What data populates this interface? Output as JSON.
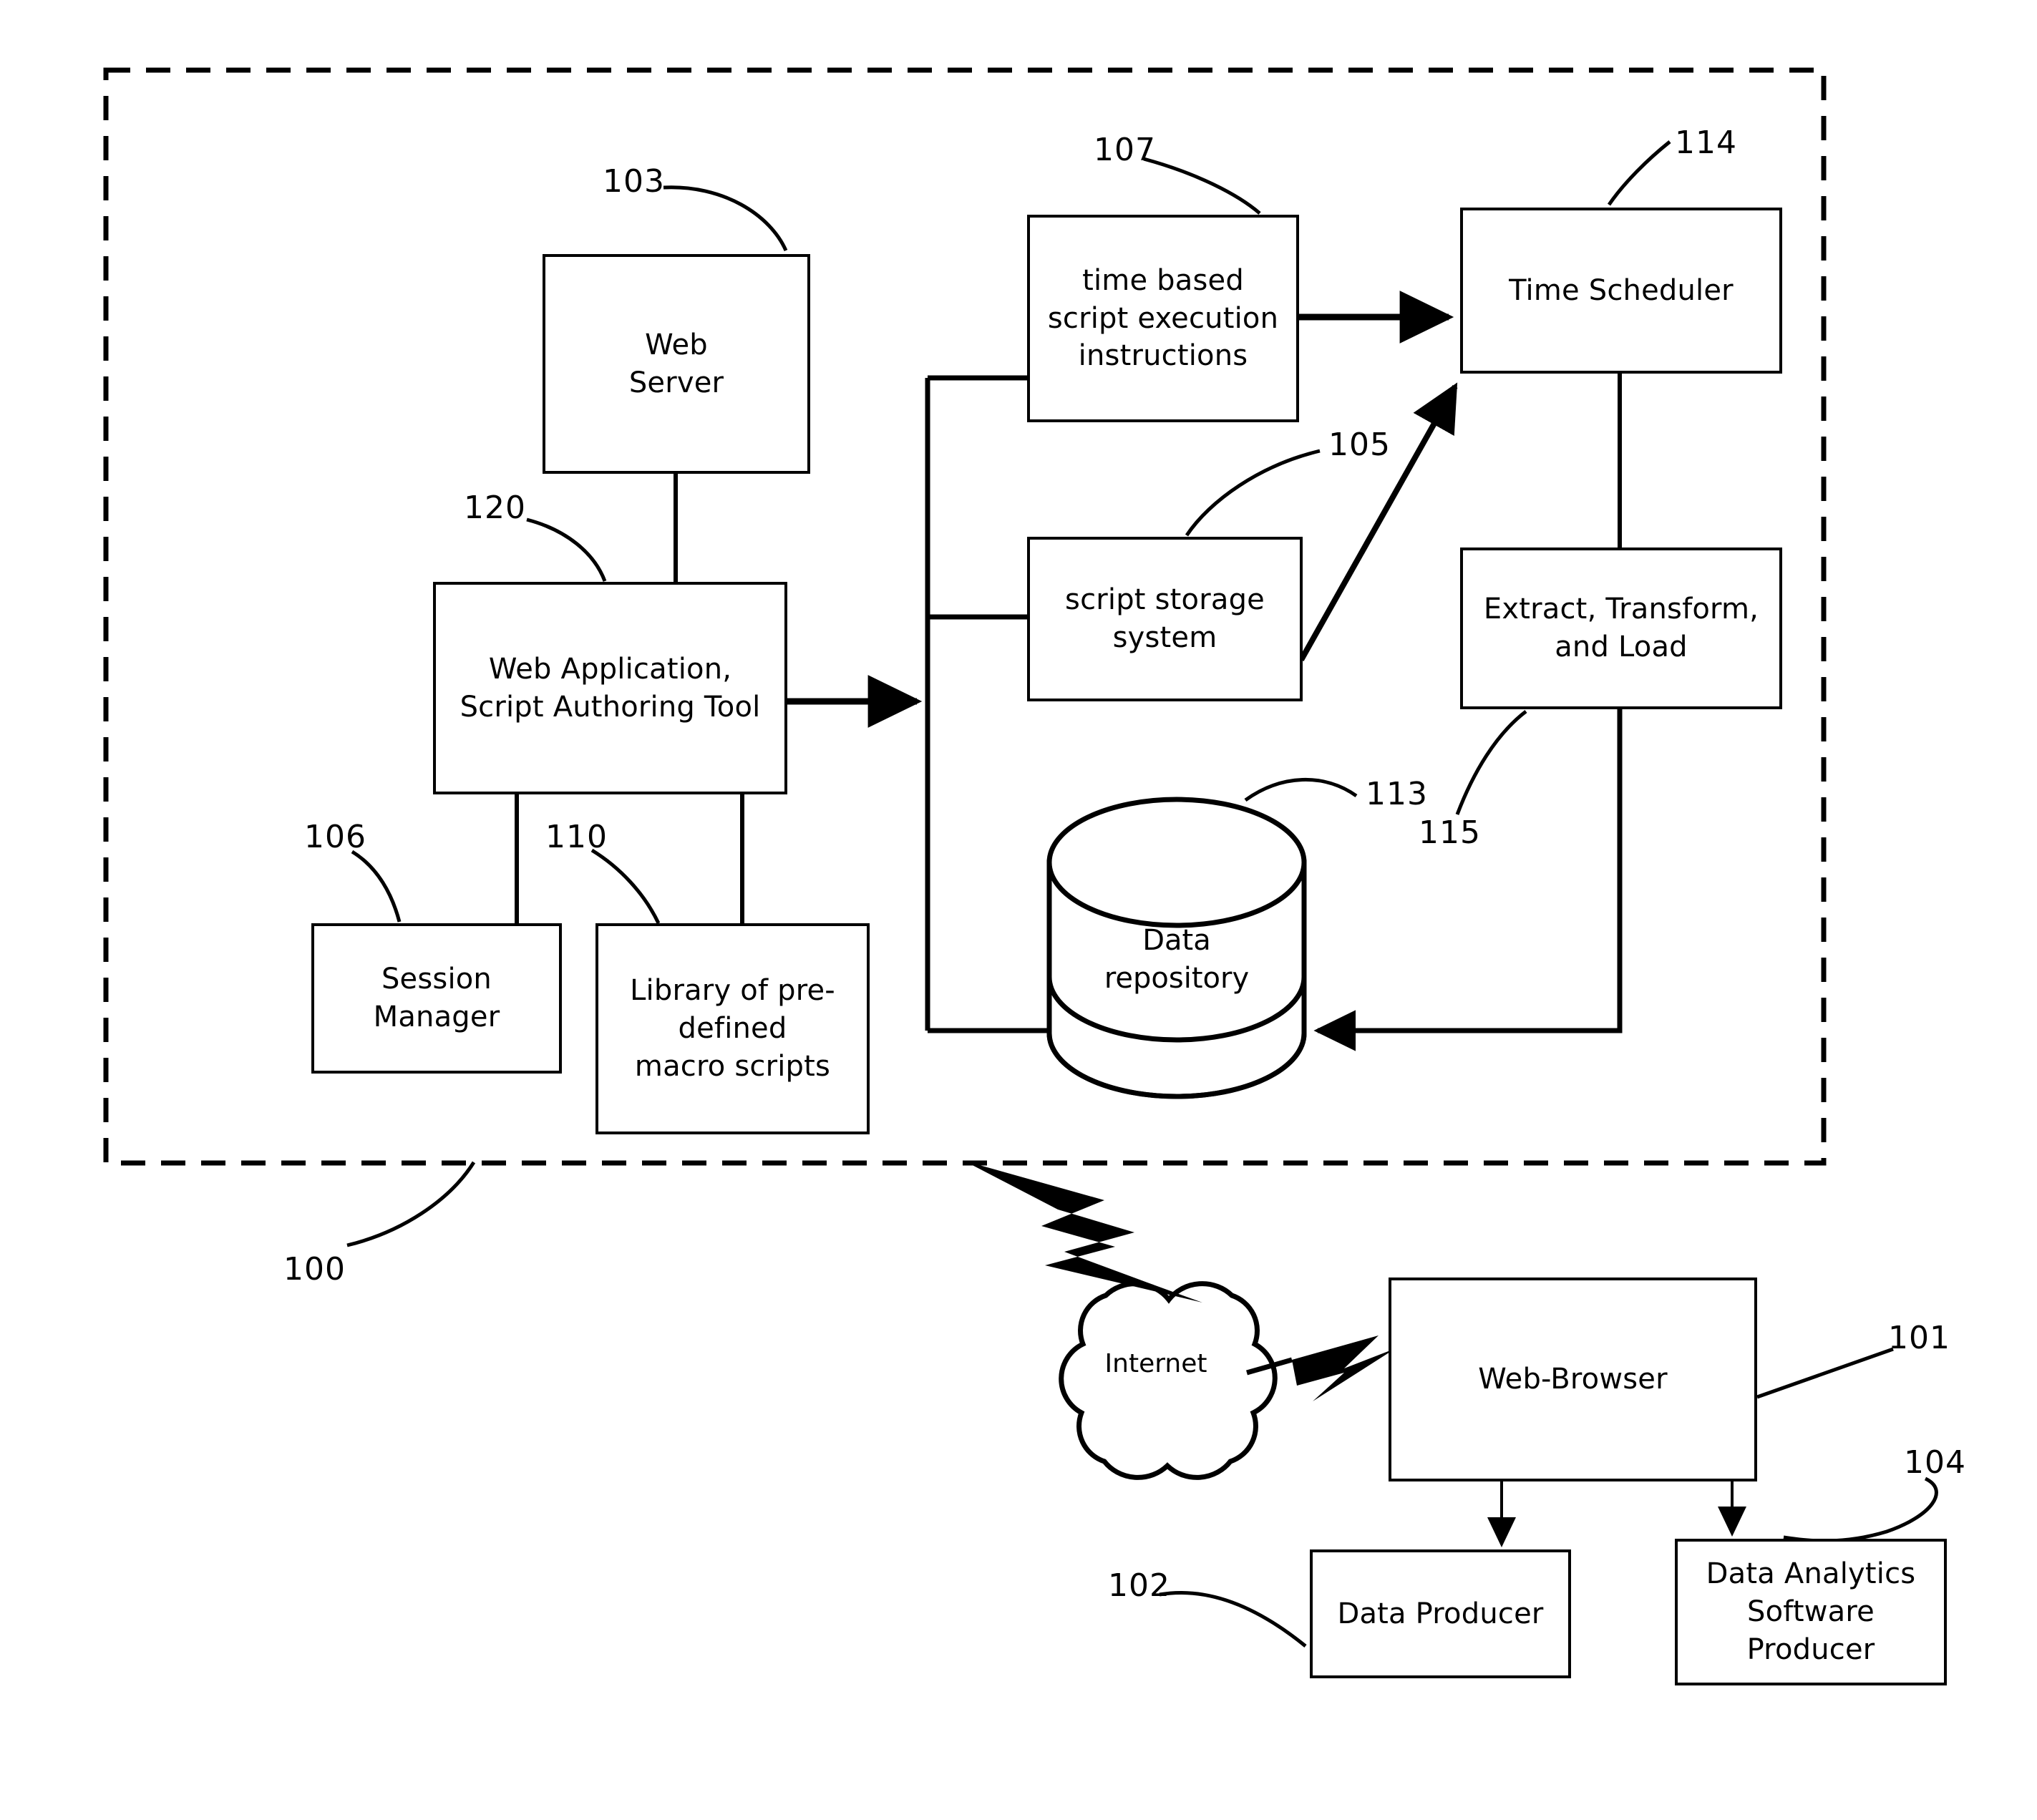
{
  "figure": {
    "kind": "patent-system-block-diagram",
    "boundary_label": "100"
  },
  "nodes": {
    "web_server": "Web\nServer",
    "web_application": "Web Application,\nScript Authoring Tool",
    "session_manager": "Session\nManager",
    "macro_library": "Library of pre-\ndefined\nmacro scripts",
    "time_based_instructions": "time based\nscript execution\ninstructions",
    "script_storage": "script storage\nsystem",
    "time_scheduler": "Time Scheduler",
    "etl": "Extract, Transform,\nand Load",
    "data_repository": "Data\nrepository",
    "internet": "Internet",
    "web_browser": "Web-Browser",
    "data_producer": "Data Producer",
    "data_analytics_producer": "Data Analytics\nSoftware\nProducer"
  },
  "reference_numerals": {
    "system_boundary": "100",
    "web_browser": "101",
    "data_producer": "102",
    "web_server": "103",
    "data_analytics_producer": "104",
    "script_storage": "105",
    "session_manager": "106",
    "time_based_instructions": "107",
    "macro_library": "110",
    "data_repository": "113",
    "time_scheduler": "114",
    "etl": "115",
    "web_application": "120"
  },
  "colors": {
    "stroke": "#000000",
    "background": "#ffffff"
  }
}
